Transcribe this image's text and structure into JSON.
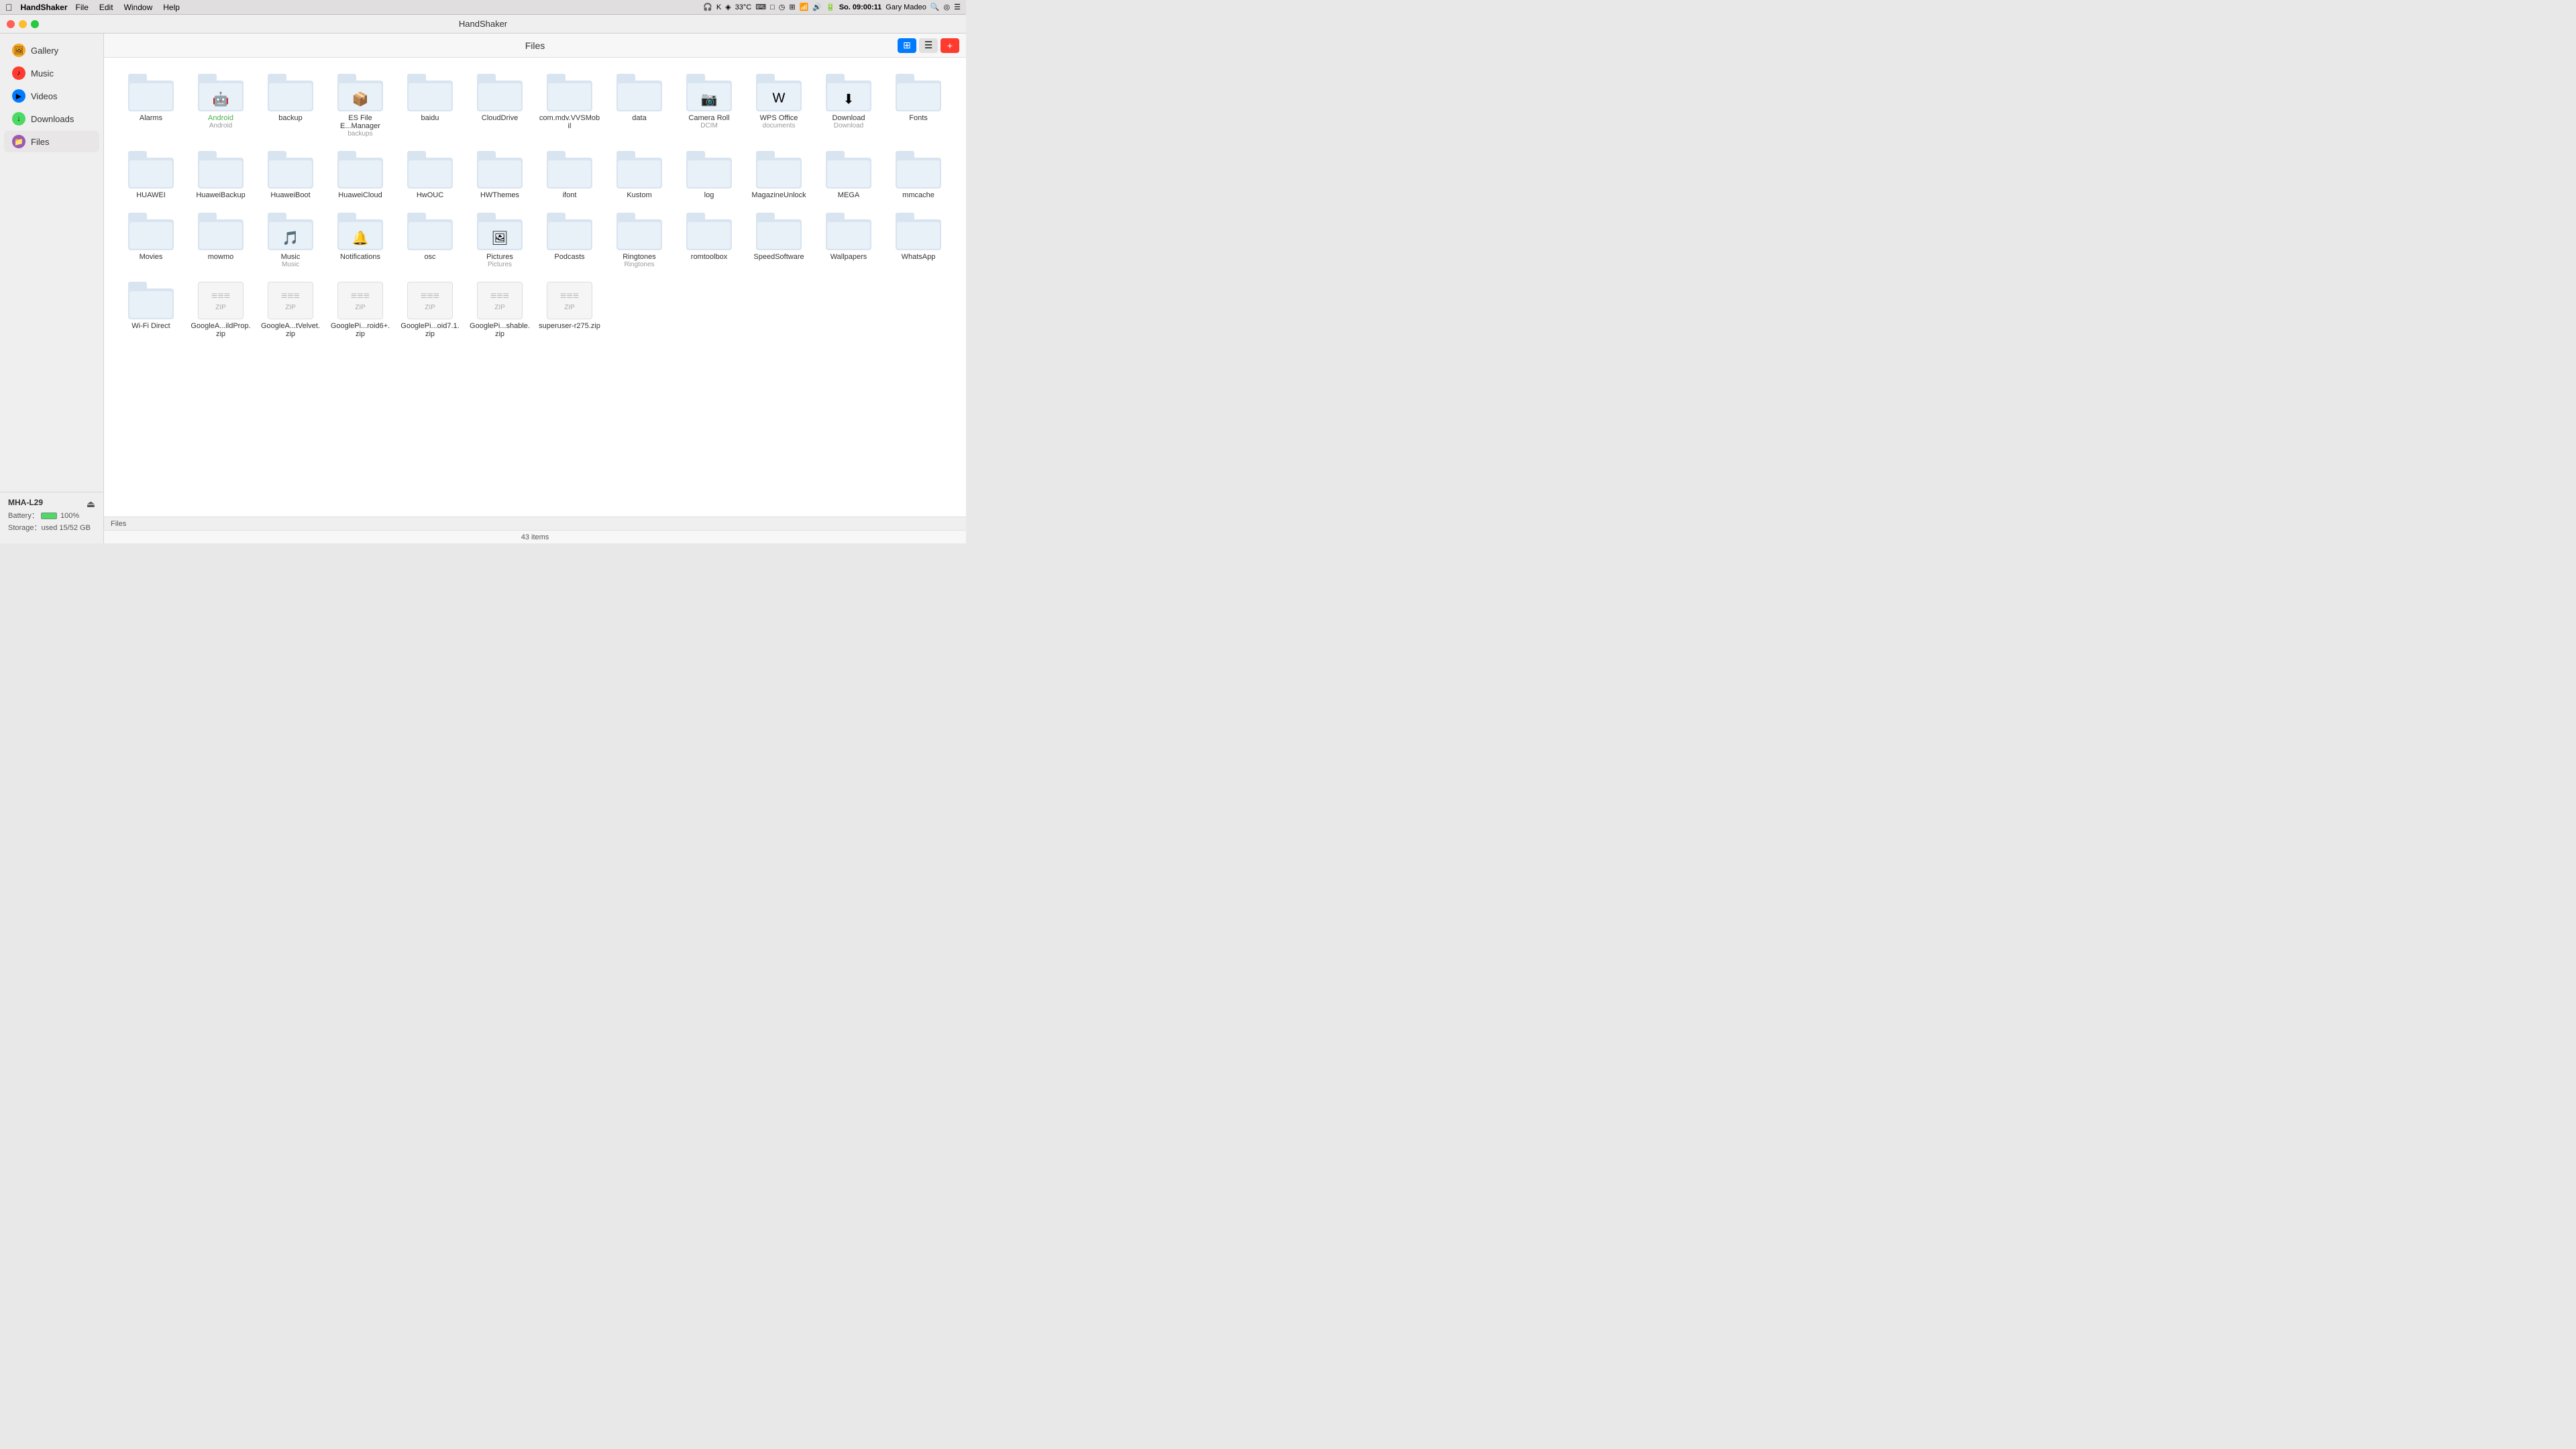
{
  "menubar": {
    "apple_symbol": "",
    "app_name": "HandShaker",
    "menu_items": [
      "File",
      "Edit",
      "Window",
      "Help"
    ],
    "right_items": [
      "🎧",
      "K",
      "◈",
      "33°C",
      "⌨",
      "□",
      "◷",
      "⟳",
      "⊞",
      "WiFi",
      "🔊",
      "🔋"
    ],
    "datetime": "So. 09:00:11",
    "username": "Gary Madeo"
  },
  "titlebar": {
    "title": "HandShaker"
  },
  "sidebar": {
    "items": [
      {
        "id": "gallery",
        "label": "Gallery",
        "icon_class": "icon-gallery",
        "icon_text": "🖼",
        "active": false
      },
      {
        "id": "music",
        "label": "Music",
        "icon_class": "icon-music",
        "icon_text": "♪",
        "active": false
      },
      {
        "id": "videos",
        "label": "Videos",
        "icon_class": "icon-videos",
        "icon_text": "▶",
        "active": false
      },
      {
        "id": "downloads",
        "label": "Downloads",
        "icon_class": "icon-downloads",
        "icon_text": "↓",
        "active": false
      },
      {
        "id": "files",
        "label": "Files",
        "icon_class": "icon-files",
        "icon_text": "📁",
        "active": true
      }
    ]
  },
  "device": {
    "name": "MHA-L29",
    "battery_label": "Battery：",
    "battery_pct": "100%",
    "storage_label": "Storage：used 15/52 GB"
  },
  "content": {
    "title": "Files",
    "item_count": "43 items",
    "path": "Files"
  },
  "files": [
    {
      "id": "alarms",
      "type": "folder",
      "name": "Alarms",
      "subtitle": ""
    },
    {
      "id": "android",
      "type": "folder",
      "name": "Android",
      "subtitle": "Android",
      "name_class": "android-label",
      "overlay": "🤖"
    },
    {
      "id": "backup",
      "type": "folder",
      "name": "backup",
      "subtitle": ""
    },
    {
      "id": "es-file-manager",
      "type": "folder",
      "name": "ES File E...Manager",
      "subtitle": "backups",
      "overlay": "📁"
    },
    {
      "id": "baidu",
      "type": "folder",
      "name": "baidu",
      "subtitle": ""
    },
    {
      "id": "clouddrive",
      "type": "folder",
      "name": "CloudDrive",
      "subtitle": ""
    },
    {
      "id": "com-mdv",
      "type": "folder",
      "name": "com.mdv.VVSMobil",
      "subtitle": ""
    },
    {
      "id": "data",
      "type": "folder",
      "name": "data",
      "subtitle": ""
    },
    {
      "id": "camera-roll",
      "type": "folder",
      "name": "Camera Roll",
      "subtitle": "DCIM",
      "overlay": "📷"
    },
    {
      "id": "wps-office",
      "type": "folder",
      "name": "WPS Office",
      "subtitle": "documents",
      "overlay": "W"
    },
    {
      "id": "download",
      "type": "folder",
      "name": "Download",
      "subtitle": "Download",
      "overlay": "⬇"
    },
    {
      "id": "fonts",
      "type": "folder",
      "name": "Fonts",
      "subtitle": ""
    },
    {
      "id": "huawei",
      "type": "folder",
      "name": "HUAWEI",
      "subtitle": ""
    },
    {
      "id": "huaweibackup",
      "type": "folder",
      "name": "HuaweiBackup",
      "subtitle": ""
    },
    {
      "id": "huaweiboot",
      "type": "folder",
      "name": "HuaweiBoot",
      "subtitle": ""
    },
    {
      "id": "huaweicloud",
      "type": "folder",
      "name": "HuaweiCloud",
      "subtitle": ""
    },
    {
      "id": "hwouc",
      "type": "folder",
      "name": "HwOUC",
      "subtitle": ""
    },
    {
      "id": "hwthemes",
      "type": "folder",
      "name": "HWThemes",
      "subtitle": ""
    },
    {
      "id": "ifont",
      "type": "folder",
      "name": "ifont",
      "subtitle": ""
    },
    {
      "id": "kustom",
      "type": "folder",
      "name": "Kustom",
      "subtitle": ""
    },
    {
      "id": "log",
      "type": "folder",
      "name": "log",
      "subtitle": ""
    },
    {
      "id": "magazineunlock",
      "type": "folder",
      "name": "MagazineUnlock",
      "subtitle": ""
    },
    {
      "id": "mega",
      "type": "folder",
      "name": "MEGA",
      "subtitle": ""
    },
    {
      "id": "mmcache",
      "type": "folder",
      "name": "mmcache",
      "subtitle": ""
    },
    {
      "id": "movies",
      "type": "folder",
      "name": "Movies",
      "subtitle": ""
    },
    {
      "id": "mowmo",
      "type": "folder",
      "name": "mowmo",
      "subtitle": ""
    },
    {
      "id": "music",
      "type": "folder",
      "name": "Music",
      "subtitle": "Music",
      "overlay": "🎵"
    },
    {
      "id": "notifications",
      "type": "folder",
      "name": "Notifications",
      "subtitle": ""
    },
    {
      "id": "osc",
      "type": "folder",
      "name": "osc",
      "subtitle": ""
    },
    {
      "id": "pictures",
      "type": "folder",
      "name": "Pictures",
      "subtitle": "Pictures",
      "overlay": "🖼"
    },
    {
      "id": "podcasts",
      "type": "folder",
      "name": "Podcasts",
      "subtitle": ""
    },
    {
      "id": "ringtones",
      "type": "folder",
      "name": "Ringtones",
      "subtitle": "Ringtones"
    },
    {
      "id": "romtoolbox",
      "type": "folder",
      "name": "romtoolbox",
      "subtitle": ""
    },
    {
      "id": "speedsoftware",
      "type": "folder",
      "name": "SpeedSoftware",
      "subtitle": ""
    },
    {
      "id": "wallpapers",
      "type": "folder",
      "name": "Wallpapers",
      "subtitle": ""
    },
    {
      "id": "whatsapp",
      "type": "folder",
      "name": "WhatsApp",
      "subtitle": ""
    },
    {
      "id": "wifi-direct",
      "type": "folder",
      "name": "Wi-Fi Direct",
      "subtitle": ""
    },
    {
      "id": "google-ildprop",
      "type": "zip",
      "name": "GoogleA...ildProp.zip",
      "subtitle": ""
    },
    {
      "id": "google-tvelvet",
      "type": "zip",
      "name": "GoogleA...tVelvet.zip",
      "subtitle": ""
    },
    {
      "id": "google-roid6",
      "type": "zip",
      "name": "GooglePi...roid6+.zip",
      "subtitle": ""
    },
    {
      "id": "google-oid71",
      "type": "zip",
      "name": "GooglePi...oid7.1.zip",
      "subtitle": ""
    },
    {
      "id": "google-shable",
      "type": "zip",
      "name": "GooglePi...shable.zip",
      "subtitle": ""
    },
    {
      "id": "superuser",
      "type": "zip",
      "name": "superuser-r275.zip",
      "subtitle": ""
    }
  ],
  "special_overlays": {
    "camera_roll": "📷",
    "android": "🤖",
    "es_file": "📁",
    "wps": "W",
    "download": "⬇",
    "music": "🎵",
    "notifications": "🔔",
    "pictures": "🖼"
  }
}
